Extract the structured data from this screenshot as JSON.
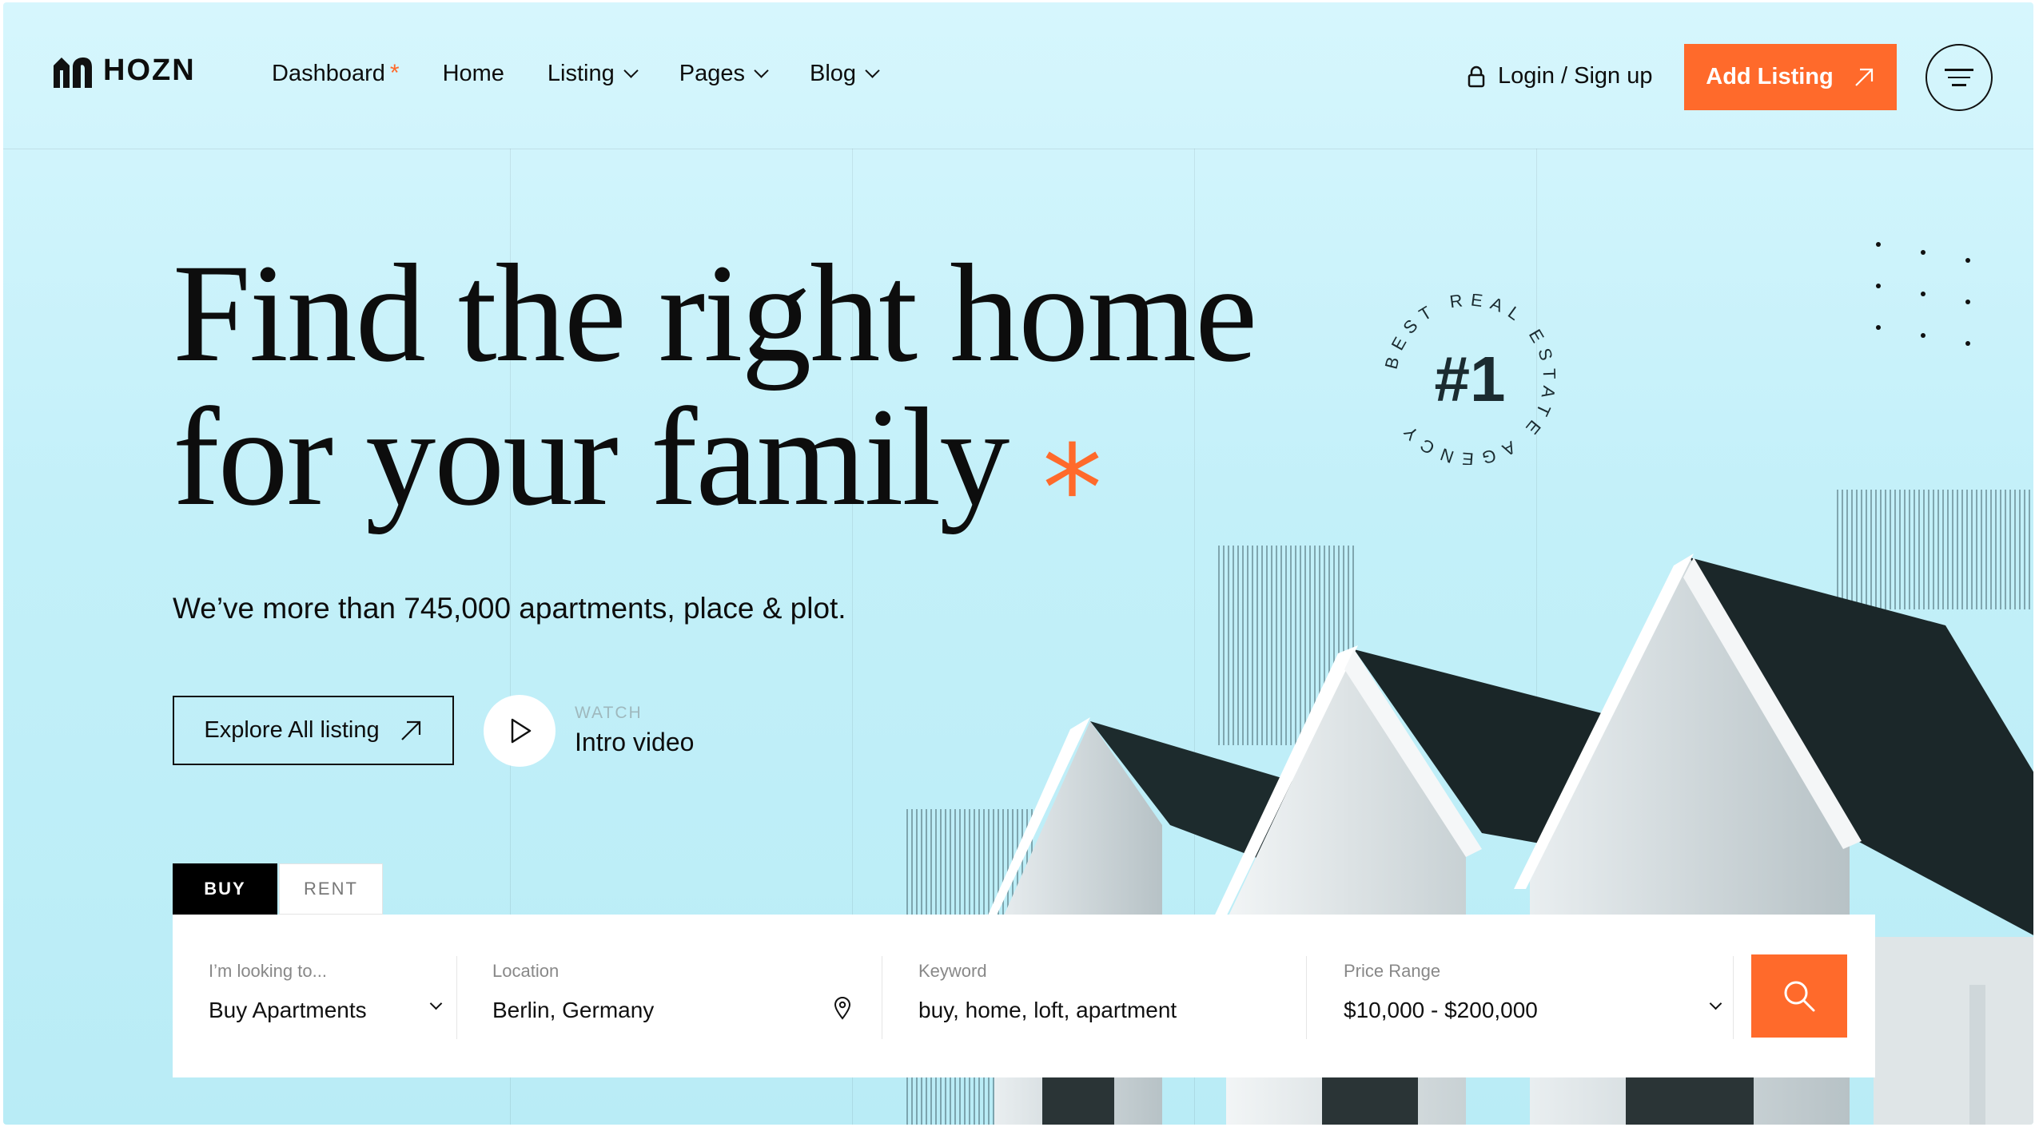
{
  "brand": {
    "name": "HOZN"
  },
  "nav": {
    "items": [
      {
        "label": "Dashboard",
        "marker": "*"
      },
      {
        "label": "Home"
      },
      {
        "label": "Listing"
      },
      {
        "label": "Pages"
      },
      {
        "label": "Blog"
      }
    ],
    "login_label": "Login / Sign up",
    "add_listing_label": "Add Listing"
  },
  "hero": {
    "headline_line1": "Find the right home",
    "headline_line2": "for your family",
    "headline_marker": "*",
    "subtitle": "We’ve more than 745,000 apartments, place & plot.",
    "explore_label": "Explore All listing",
    "watch_small": "WATCH",
    "watch_big": "Intro video"
  },
  "badge": {
    "number": "#1",
    "ring_text": "BEST REAL ESTATE AGENCY"
  },
  "search": {
    "tabs": [
      {
        "label": "BUY",
        "active": true
      },
      {
        "label": "RENT",
        "active": false
      }
    ],
    "fields": [
      {
        "label": "I’m looking to...",
        "value": "Buy Apartments"
      },
      {
        "label": "Location",
        "value": "Berlin, Germany"
      },
      {
        "label": "Keyword",
        "value": "buy, home, loft, apartment"
      },
      {
        "label": "Price Range",
        "value": "$10,000 - $200,000"
      }
    ]
  },
  "colors": {
    "accent": "#ff6a2b",
    "background": "#c3f0f9",
    "roof": "#1c2a2c"
  }
}
